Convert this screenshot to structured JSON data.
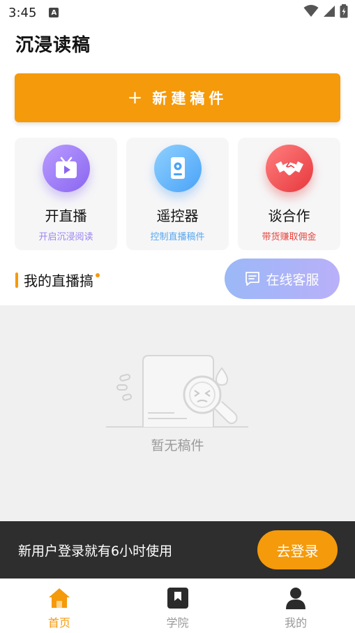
{
  "status_bar": {
    "time": "3:45",
    "notification_icon": "a-letter-icon",
    "icons": [
      "wifi-icon",
      "signal-icon",
      "battery-icon"
    ]
  },
  "app": {
    "title": "沉浸读稿"
  },
  "new_button": {
    "plus": "+",
    "label": "新建稿件"
  },
  "features": [
    {
      "icon": "tv-icon",
      "name": "开直播",
      "sub": "开启沉浸阅读",
      "sub_color": "#9b84f0"
    },
    {
      "icon": "remote-icon",
      "name": "遥控器",
      "sub": "控制直播稿件",
      "sub_color": "#5aa8f0"
    },
    {
      "icon": "handshake-icon",
      "name": "谈合作",
      "sub": "带货赚取佣金",
      "sub_color": "#e8453f"
    }
  ],
  "section": {
    "title": "我的直播搞"
  },
  "service_button": {
    "label": "在线客服",
    "icon": "chat-icon"
  },
  "empty_state": {
    "text": "暂无稿件",
    "icon": "empty-search-icon"
  },
  "login_banner": {
    "text": "新用户登录就有6小时使用",
    "button": "去登录"
  },
  "tabs": [
    {
      "label": "首页",
      "icon": "home-icon",
      "active": true
    },
    {
      "label": "学院",
      "icon": "bookmark-icon",
      "active": false
    },
    {
      "label": "我的",
      "icon": "user-icon",
      "active": false
    }
  ],
  "colors": {
    "accent": "#f59a0b",
    "inactive_tab": "#999999",
    "banner_bg": "#2e2e2e"
  }
}
